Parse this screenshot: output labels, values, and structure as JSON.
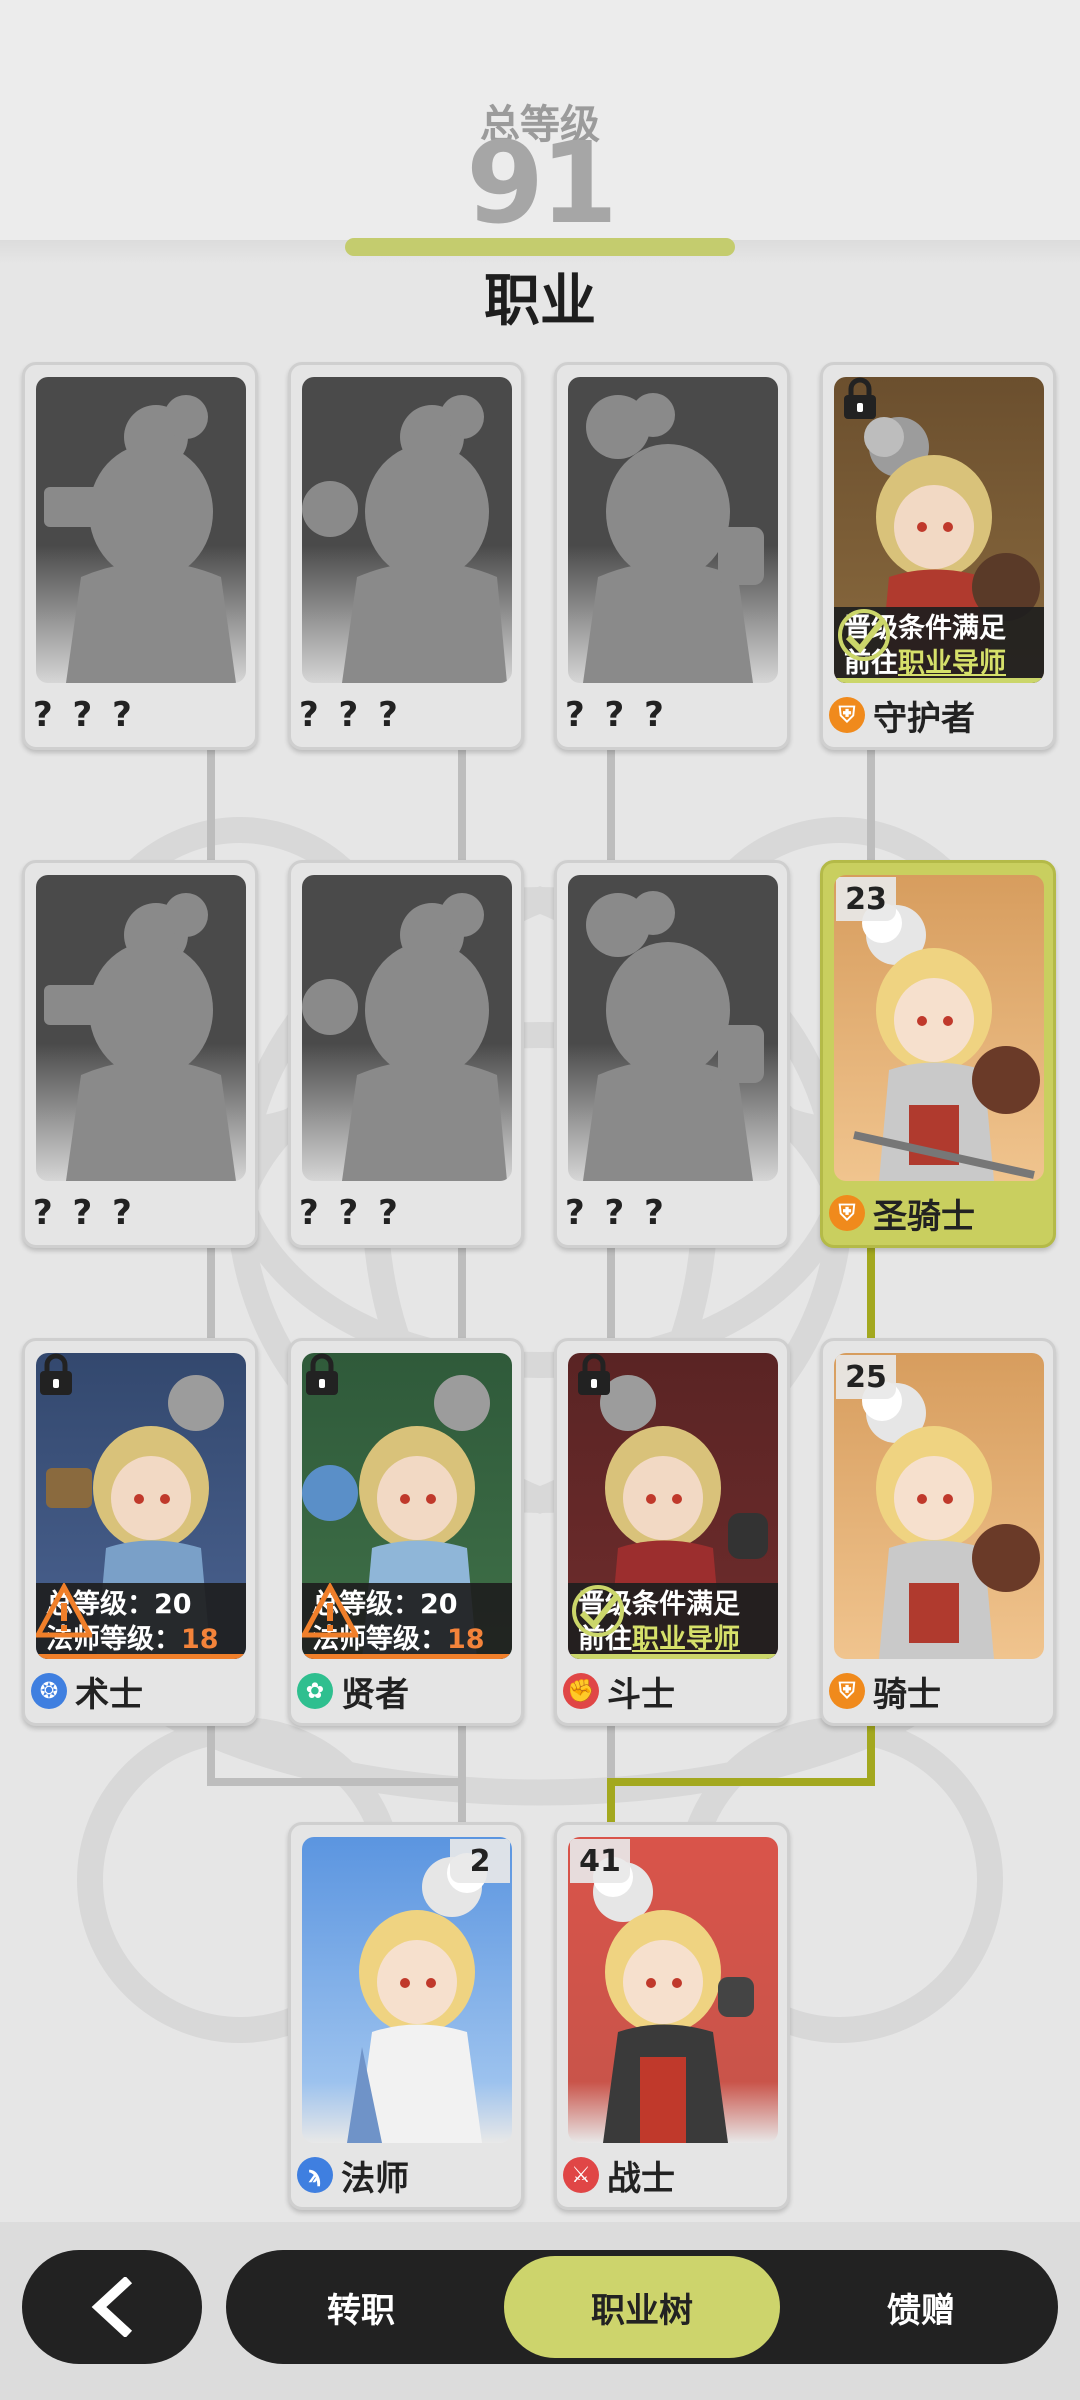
{
  "header": {
    "total_level_label": "总等级",
    "total_level_value": "91",
    "title": "职业"
  },
  "cards": {
    "r1c1": {
      "name": "? ? ?"
    },
    "r1c2": {
      "name": "? ? ?"
    },
    "r1c3": {
      "name": "? ? ?"
    },
    "r1c4": {
      "name": "守护者",
      "line1": "晋级条件满足",
      "line2_prefix": "前往",
      "line2_link": "职业导师",
      "icon": "shield-guard-icon"
    },
    "r2c1": {
      "name": "? ? ?"
    },
    "r2c2": {
      "name": "? ? ?"
    },
    "r2c3": {
      "name": "? ? ?"
    },
    "r2c4": {
      "name": "圣骑士",
      "level": "23",
      "icon": "holy-shield-icon"
    },
    "r3c1": {
      "name": "术士",
      "line1": "总等级：20",
      "line2_prefix": "法师等级：",
      "line2_value": "18",
      "icon": "warlock-icon"
    },
    "r3c2": {
      "name": "贤者",
      "line1": "总等级：20",
      "line2_prefix": "法师等级：",
      "line2_value": "18",
      "icon": "sage-icon"
    },
    "r3c3": {
      "name": "斗士",
      "line1": "晋级条件满足",
      "line2_prefix": "前往",
      "line2_link": "职业导师",
      "icon": "fighter-icon"
    },
    "r3c4": {
      "name": "骑士",
      "level": "25",
      "icon": "knight-icon"
    },
    "r4c2": {
      "name": "法师",
      "level": "2",
      "icon": "mage-staff-icon"
    },
    "r4c3": {
      "name": "战士",
      "level": "41",
      "icon": "warrior-sword-icon"
    }
  },
  "colors": {
    "accent": "#cdd46c",
    "active_card": "#c9cf5f",
    "path_active": "#a3a81f",
    "path_inactive": "#bdbdbd",
    "warning": "#f07f2a",
    "dark": "#222222"
  },
  "bottom_nav": {
    "back_icon": "chevron-left-icon",
    "tabs": [
      "转职",
      "职业树",
      "馈赠"
    ],
    "selected_tab": "职业树"
  }
}
